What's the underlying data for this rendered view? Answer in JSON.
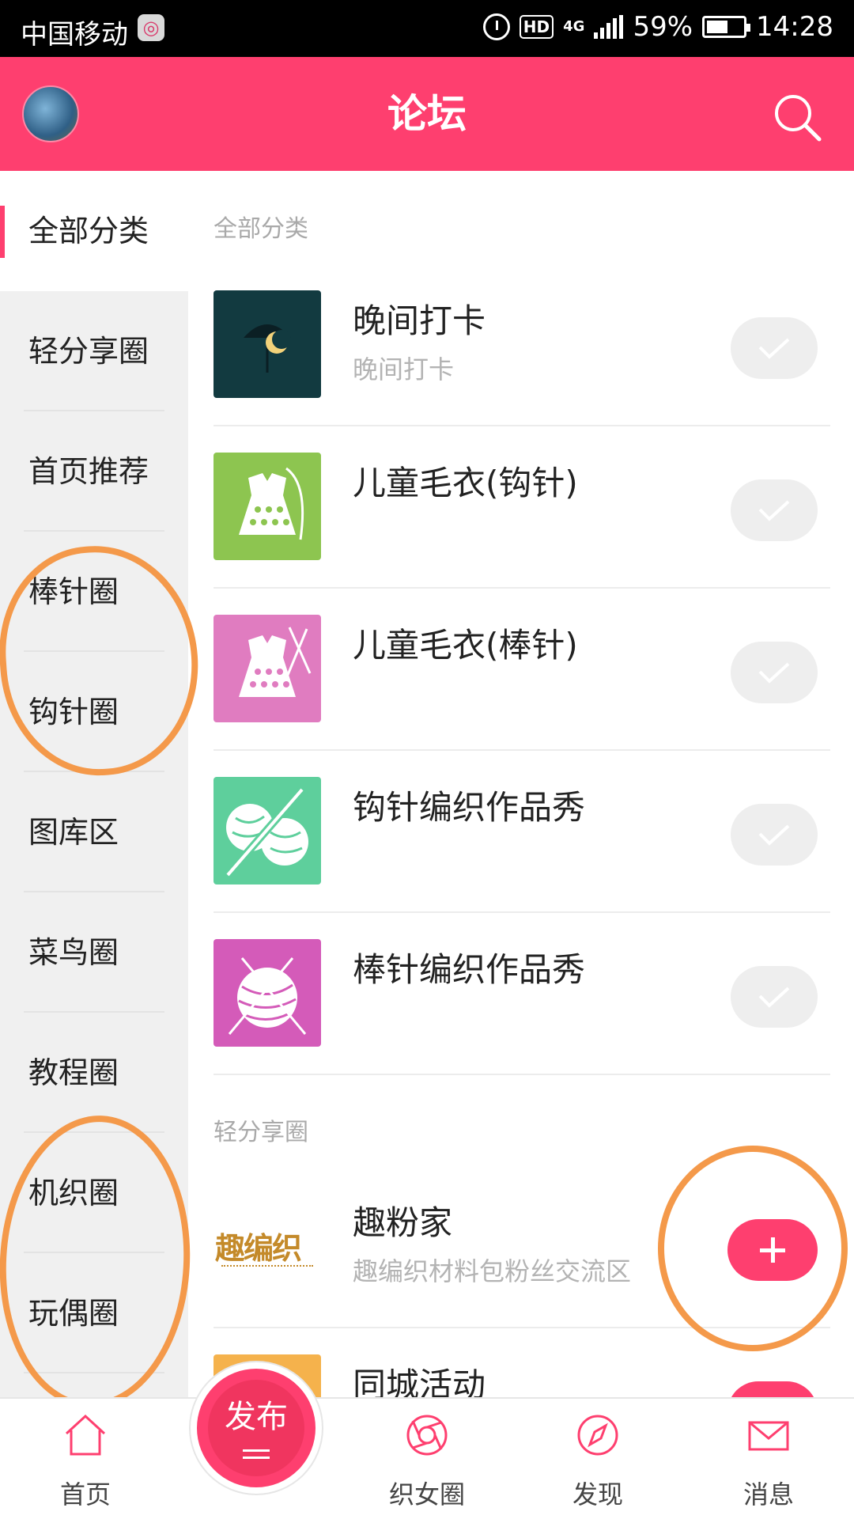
{
  "status_bar": {
    "carrier": "中国移动",
    "network": "4G",
    "battery": "59%",
    "battery_level": 0.59,
    "time": "14:28"
  },
  "header": {
    "title": "论坛"
  },
  "sidebar": {
    "items": [
      {
        "label": "全部分类",
        "active": true
      },
      {
        "label": "轻分享圈"
      },
      {
        "label": "首页推荐"
      },
      {
        "label": "棒针圈"
      },
      {
        "label": "钩针圈"
      },
      {
        "label": "图库区"
      },
      {
        "label": "菜鸟圈"
      },
      {
        "label": "教程圈"
      },
      {
        "label": "机织圈"
      },
      {
        "label": "玩偶圈"
      }
    ]
  },
  "main": {
    "sections": [
      {
        "title": "全部分类",
        "rows": [
          {
            "name": "晚间打卡",
            "subtitle": "晚间打卡",
            "state": "joined"
          },
          {
            "name": "儿童毛衣(钩针)",
            "state": "joined"
          },
          {
            "name": "儿童毛衣(棒针)",
            "state": "joined"
          },
          {
            "name": "钩针编织作品秀",
            "state": "joined"
          },
          {
            "name": "棒针编织作品秀",
            "state": "joined"
          }
        ]
      },
      {
        "title": "轻分享圈",
        "rows": [
          {
            "name": "趣粉家",
            "subtitle": "趣编织材料包粉丝交流区",
            "logo_text": "趣编织",
            "state": "add"
          },
          {
            "name": "同城活动",
            "state": "add"
          }
        ]
      }
    ]
  },
  "tabbar": {
    "items": [
      {
        "label": "首页"
      },
      {
        "label": "发布"
      },
      {
        "label": "织女圈"
      },
      {
        "label": "发现"
      },
      {
        "label": "消息"
      }
    ]
  },
  "colors": {
    "accent": "#fe3f6f",
    "annotation": "#f4994a"
  }
}
